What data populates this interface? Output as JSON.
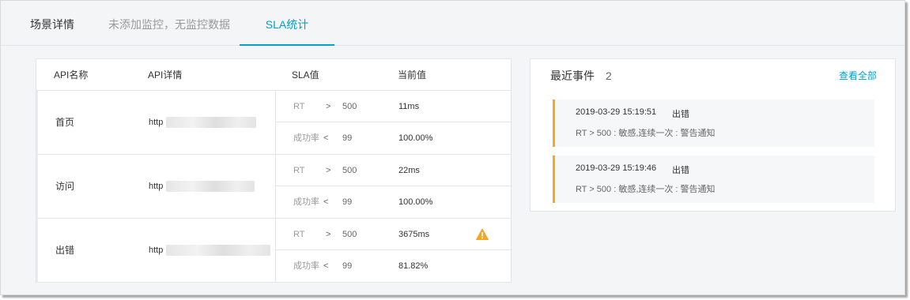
{
  "tabs": [
    {
      "label": "场景详情"
    },
    {
      "label": "未添加监控，无监控数据"
    },
    {
      "label": "SLA统计"
    }
  ],
  "table": {
    "headers": [
      "API名称",
      "API详情",
      "SLA值",
      "当前值"
    ],
    "rows": [
      {
        "name": "首页",
        "url_prefix": "http",
        "metrics": [
          {
            "metric": "RT",
            "op": ">",
            "threshold": "500",
            "current": "11ms",
            "warning": false
          },
          {
            "metric": "成功率",
            "op": "<",
            "threshold": "99",
            "current": "100.00%",
            "warning": false
          }
        ]
      },
      {
        "name": "访问",
        "url_prefix": "http",
        "metrics": [
          {
            "metric": "RT",
            "op": ">",
            "threshold": "500",
            "current": "22ms",
            "warning": false
          },
          {
            "metric": "成功率",
            "op": "<",
            "threshold": "99",
            "current": "100.00%",
            "warning": false
          }
        ]
      },
      {
        "name": "出错",
        "url_prefix": "http",
        "metrics": [
          {
            "metric": "RT",
            "op": ">",
            "threshold": "500",
            "current": "3675ms",
            "warning": true
          },
          {
            "metric": "成功率",
            "op": "<",
            "threshold": "99",
            "current": "81.82%",
            "warning": false
          }
        ]
      }
    ]
  },
  "events": {
    "title": "最近事件",
    "count": "2",
    "view_all": "查看全部",
    "items": [
      {
        "time": "2019-03-29 15:19:51",
        "type": "出错",
        "desc": "RT > 500 : 敏感,连续一次 : 警告通知"
      },
      {
        "time": "2019-03-29 15:19:46",
        "type": "出错",
        "desc": "RT > 500 : 敏感,连续一次 : 警告通知"
      }
    ]
  },
  "colors": {
    "accent": "#00a2ca",
    "warning": "#f5a623"
  },
  "icons": {
    "warning": "warning-icon"
  }
}
